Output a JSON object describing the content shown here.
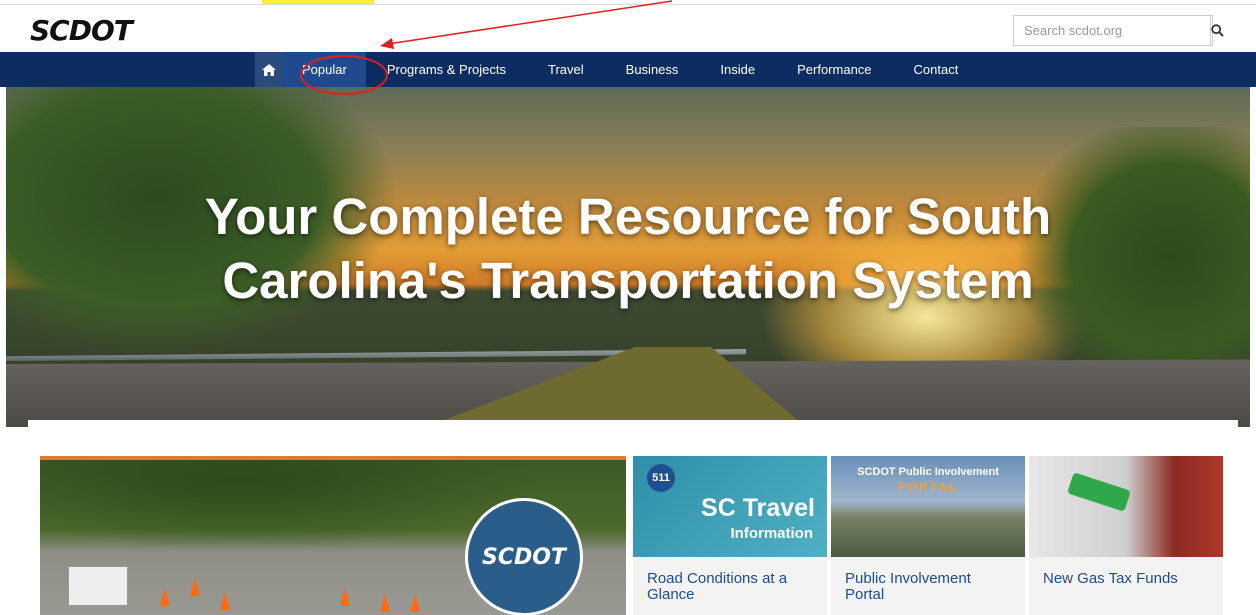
{
  "header": {
    "logo_text": "SCDOT",
    "search_placeholder": "Search scdot.org",
    "search_icon": "magnifier-icon"
  },
  "nav": {
    "home_icon": "home-icon",
    "items": [
      {
        "label": "Popular"
      },
      {
        "label": "Programs & Projects"
      },
      {
        "label": "Travel"
      },
      {
        "label": "Business"
      },
      {
        "label": "Inside"
      },
      {
        "label": "Performance"
      },
      {
        "label": "Contact"
      }
    ]
  },
  "hero": {
    "title_line1": "Your Complete Resource for South",
    "title_line2": "Carolina's Transportation System"
  },
  "feature": {
    "seal_text": "SCDOT"
  },
  "cards": [
    {
      "label": "Road Conditions at a Glance",
      "thumb_title": "SC Travel",
      "thumb_subtitle": "Information",
      "badge": "511"
    },
    {
      "label": "Public Involvement Portal",
      "thumb_title": "SCDOT Public Involvement",
      "thumb_subtitle": "PORTAL"
    },
    {
      "label": "New Gas Tax Funds"
    }
  ],
  "colors": {
    "nav_bg": "#0d2d62",
    "link": "#1c4d8c",
    "annotation": "#e02020",
    "highlight": "#ffee33"
  }
}
